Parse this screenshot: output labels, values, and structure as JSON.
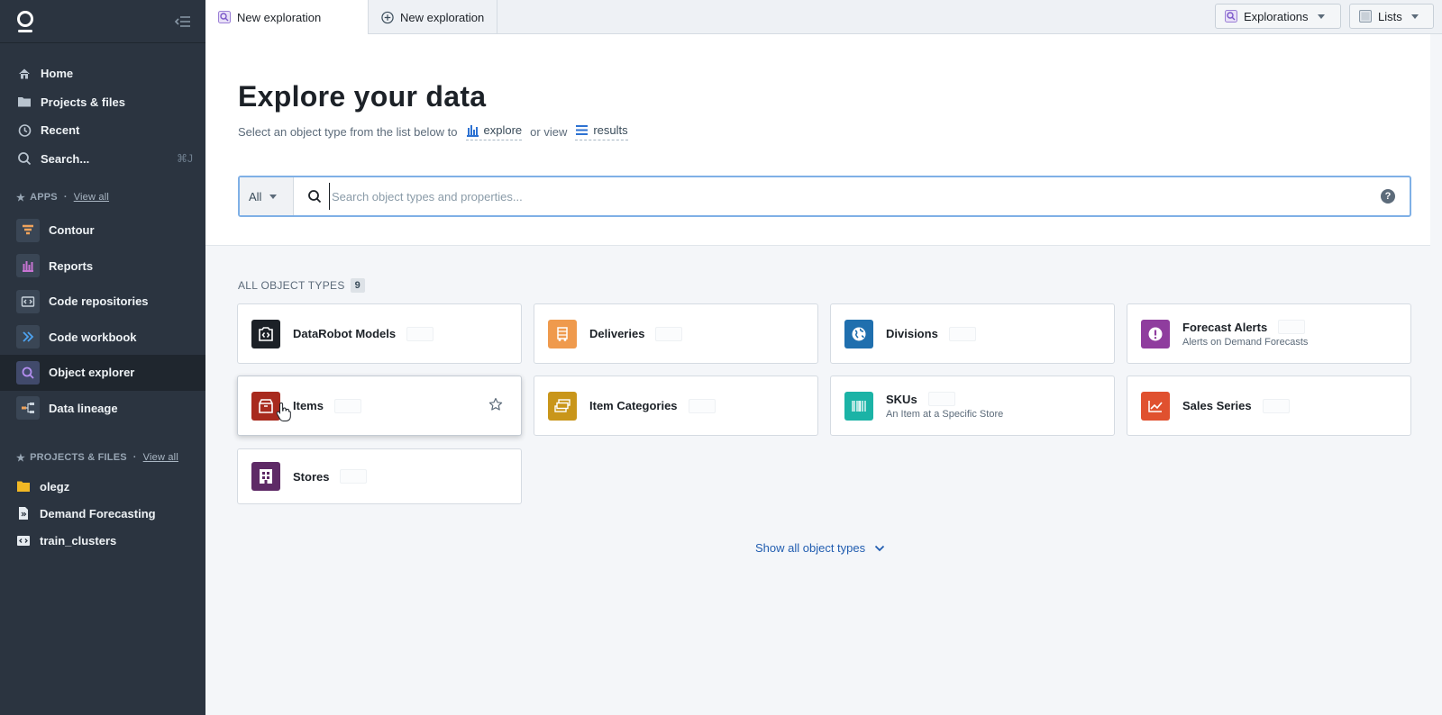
{
  "sidebar": {
    "nav": [
      {
        "label": "Home",
        "icon": "home-icon"
      },
      {
        "label": "Projects & files",
        "icon": "folder-icon"
      },
      {
        "label": "Recent",
        "icon": "history-icon"
      },
      {
        "label": "Search...",
        "icon": "search-icon",
        "shortcut": "⌘J"
      }
    ],
    "apps_header": "APPS",
    "apps_view_all": "View all",
    "apps": [
      {
        "label": "Contour",
        "icon": "contour-icon"
      },
      {
        "label": "Reports",
        "icon": "reports-icon"
      },
      {
        "label": "Code repositories",
        "icon": "code-repositories-icon"
      },
      {
        "label": "Code workbook",
        "icon": "code-workbook-icon"
      },
      {
        "label": "Object explorer",
        "icon": "object-explorer-icon",
        "active": true
      },
      {
        "label": "Data lineage",
        "icon": "data-lineage-icon"
      }
    ],
    "projects_header": "PROJECTS & FILES",
    "projects_view_all": "View all",
    "projects": [
      {
        "label": "olegz",
        "icon": "folder-icon"
      },
      {
        "label": "Demand Forecasting",
        "icon": "code-workbook-file-icon"
      },
      {
        "label": "train_clusters",
        "icon": "code-repository-file-icon"
      }
    ]
  },
  "topbar": {
    "tabs": [
      {
        "label": "New exploration",
        "icon": "explorer-icon",
        "active": true
      },
      {
        "label": "New exploration",
        "icon": "add-circle-icon",
        "active": false
      }
    ],
    "explorations_label": "Explorations",
    "lists_label": "Lists"
  },
  "header": {
    "title": "Explore your data",
    "subtitle_prefix": "Select an object type from the list below to",
    "explore_label": "explore",
    "or_view": "or view",
    "results_label": "results"
  },
  "search": {
    "scope": "All",
    "placeholder": "Search object types and properties...",
    "help": "?"
  },
  "object_types": {
    "header": "ALL OBJECT TYPES",
    "count": "9",
    "items": [
      {
        "title": "DataRobot Models",
        "desc": "",
        "color": "#1c2127",
        "icon": "datarobot-icon"
      },
      {
        "title": "Deliveries",
        "desc": "",
        "color": "#ef9a4d",
        "icon": "deliveries-icon"
      },
      {
        "title": "Divisions",
        "desc": "",
        "color": "#1f6fae",
        "icon": "globe-icon"
      },
      {
        "title": "Forecast Alerts",
        "desc": "Alerts on Demand Forecasts",
        "color": "#8f3d9e",
        "icon": "alert-icon"
      },
      {
        "title": "Items",
        "desc": "",
        "color": "#a82a1e",
        "icon": "box-icon"
      },
      {
        "title": "Item Categories",
        "desc": "",
        "color": "#c9961a",
        "icon": "categories-icon"
      },
      {
        "title": "SKUs",
        "desc": "An Item at a Specific Store",
        "color": "#1bb3a6",
        "icon": "barcode-icon"
      },
      {
        "title": "Sales Series",
        "desc": "",
        "color": "#e0512f",
        "icon": "chart-line-icon"
      },
      {
        "title": "Stores",
        "desc": "",
        "color": "#5e2a66",
        "icon": "building-icon"
      }
    ]
  },
  "show_all_label": "Show all object types"
}
